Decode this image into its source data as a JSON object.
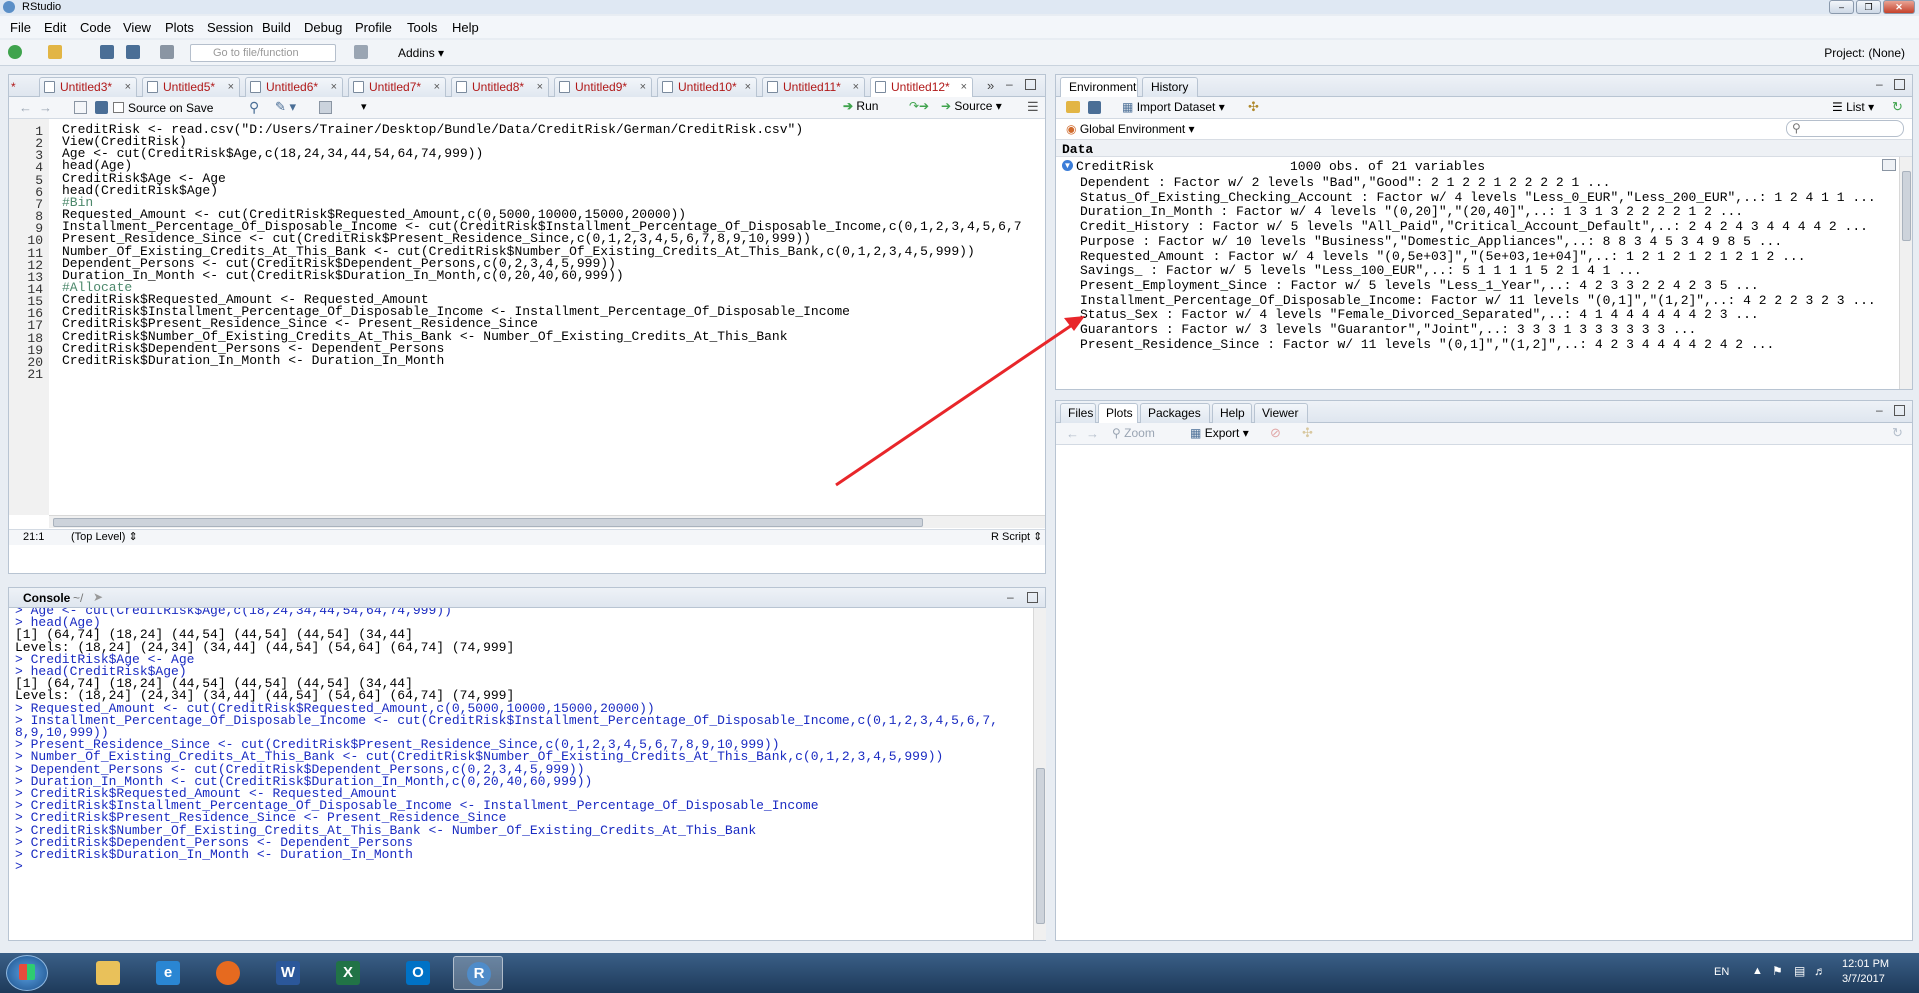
{
  "window": {
    "title": "RStudio"
  },
  "menu": [
    "File",
    "Edit",
    "Code",
    "View",
    "Plots",
    "Session",
    "Build",
    "Debug",
    "Profile",
    "Tools",
    "Help"
  ],
  "toolbar": {
    "goto_placeholder": "Go to file/function",
    "addins": "Addins",
    "project": "Project: (None)"
  },
  "editor": {
    "tabs": [
      "Untitled3*",
      "Untitled5*",
      "Untitled6*",
      "Untitled7*",
      "Untitled8*",
      "Untitled9*",
      "Untitled10*",
      "Untitled11*",
      "Untitled12*"
    ],
    "first_tab_partial": "*",
    "source_on_save": "Source on Save",
    "run": "Run",
    "source": "Source",
    "lines": [
      "CreditRisk <- read.csv(\"D:/Users/Trainer/Desktop/Bundle/Data/CreditRisk/German/CreditRisk.csv\")",
      "View(CreditRisk)",
      "Age <- cut(CreditRisk$Age,c(18,24,34,44,54,64,74,999))",
      "head(Age)",
      "CreditRisk$Age <- Age",
      "head(CreditRisk$Age)",
      "#Bin",
      "Requested_Amount <- cut(CreditRisk$Requested_Amount,c(0,5000,10000,15000,20000))",
      "Installment_Percentage_Of_Disposable_Income <- cut(CreditRisk$Installment_Percentage_Of_Disposable_Income,c(0,1,2,3,4,5,6,7",
      "Present_Residence_Since <- cut(CreditRisk$Present_Residence_Since,c(0,1,2,3,4,5,6,7,8,9,10,999))",
      "Number_Of_Existing_Credits_At_This_Bank <- cut(CreditRisk$Number_Of_Existing_Credits_At_This_Bank,c(0,1,2,3,4,5,999))",
      "Dependent_Persons <- cut(CreditRisk$Dependent_Persons,c(0,2,3,4,5,999))",
      "Duration_In_Month <- cut(CreditRisk$Duration_In_Month,c(0,20,40,60,999))",
      "#Allocate",
      "CreditRisk$Requested_Amount <- Requested_Amount",
      "CreditRisk$Installment_Percentage_Of_Disposable_Income <- Installment_Percentage_Of_Disposable_Income",
      "CreditRisk$Present_Residence_Since <- Present_Residence_Since",
      "CreditRisk$Number_Of_Existing_Credits_At_This_Bank <- Number_Of_Existing_Credits_At_This_Bank",
      "CreditRisk$Dependent_Persons <- Dependent_Persons",
      "CreditRisk$Duration_In_Month <- Duration_In_Month",
      ""
    ],
    "cursor_pos": "21:1",
    "scope": "(Top Level)",
    "file_type": "R Script"
  },
  "console": {
    "title": "Console",
    "path": "~/",
    "lines": [
      {
        "t": "> Age <- cut(CreditRisk$Age,c(18,24,34,44,54,64,74,999))",
        "cmd": true
      },
      {
        "t": "> head(Age)",
        "cmd": true
      },
      {
        "t": "[1] (64,74] (18,24] (44,54] (44,54] (44,54] (34,44]",
        "cmd": false
      },
      {
        "t": "Levels: (18,24] (24,34] (34,44] (44,54] (54,64] (64,74] (74,999]",
        "cmd": false
      },
      {
        "t": "> CreditRisk$Age <- Age",
        "cmd": true
      },
      {
        "t": "> head(CreditRisk$Age)",
        "cmd": true
      },
      {
        "t": "[1] (64,74] (18,24] (44,54] (44,54] (44,54] (34,44]",
        "cmd": false
      },
      {
        "t": "Levels: (18,24] (24,34] (34,44] (44,54] (54,64] (64,74] (74,999]",
        "cmd": false
      },
      {
        "t": "> Requested_Amount <- cut(CreditRisk$Requested_Amount,c(0,5000,10000,15000,20000))",
        "cmd": true
      },
      {
        "t": "> Installment_Percentage_Of_Disposable_Income <- cut(CreditRisk$Installment_Percentage_Of_Disposable_Income,c(0,1,2,3,4,5,6,7,",
        "cmd": true
      },
      {
        "t": "8,9,10,999))",
        "cmd": true
      },
      {
        "t": "> Present_Residence_Since <- cut(CreditRisk$Present_Residence_Since,c(0,1,2,3,4,5,6,7,8,9,10,999))",
        "cmd": true
      },
      {
        "t": "> Number_Of_Existing_Credits_At_This_Bank <- cut(CreditRisk$Number_Of_Existing_Credits_At_This_Bank,c(0,1,2,3,4,5,999))",
        "cmd": true
      },
      {
        "t": "> Dependent_Persons <- cut(CreditRisk$Dependent_Persons,c(0,2,3,4,5,999))",
        "cmd": true
      },
      {
        "t": "> Duration_In_Month <- cut(CreditRisk$Duration_In_Month,c(0,20,40,60,999))",
        "cmd": true
      },
      {
        "t": "> CreditRisk$Requested_Amount <- Requested_Amount",
        "cmd": true
      },
      {
        "t": "> CreditRisk$Installment_Percentage_Of_Disposable_Income <- Installment_Percentage_Of_Disposable_Income",
        "cmd": true
      },
      {
        "t": "> CreditRisk$Present_Residence_Since <- Present_Residence_Since",
        "cmd": true
      },
      {
        "t": "> CreditRisk$Number_Of_Existing_Credits_At_This_Bank <- Number_Of_Existing_Credits_At_This_Bank",
        "cmd": true
      },
      {
        "t": "> CreditRisk$Dependent_Persons <- Dependent_Persons",
        "cmd": true
      },
      {
        "t": "> CreditRisk$Duration_In_Month <- Duration_In_Month",
        "cmd": true
      },
      {
        "t": "> ",
        "cmd": true
      }
    ]
  },
  "environment": {
    "tabs": [
      "Environment",
      "History"
    ],
    "import_dataset": "Import Dataset",
    "view_mode": "List",
    "scope": "Global Environment",
    "section": "Data",
    "object_name": "CreditRisk",
    "object_summary": "1000 obs. of 21 variables",
    "rows": [
      "Dependent : Factor w/ 2 levels \"Bad\",\"Good\": 2 1 2 2 1 2 2 2 2 1 ...",
      "Status_Of_Existing_Checking_Account : Factor w/ 4 levels \"Less_0_EUR\",\"Less_200_EUR\",..: 1 2 4 1 1 ...",
      "Duration_In_Month : Factor w/ 4 levels \"(0,20]\",\"(20,40]\",..: 1 3 1 3 2 2 2 2 1 2 ...",
      "Credit_History : Factor w/ 5 levels \"All_Paid\",\"Critical_Account_Default\",..: 2 4 2 4 3 4 4 4 4 2 ...",
      "Purpose : Factor w/ 10 levels \"Business\",\"Domestic_Appliances\",..: 8 8 3 4 5 3 4 9 8 5 ...",
      "Requested_Amount : Factor w/ 4 levels \"(0,5e+03]\",\"(5e+03,1e+04]\",..: 1 2 1 2 1 2 1 2 1 2 ...",
      "Savings_ : Factor w/ 5 levels \"Less_100_EUR\",..: 5 1 1 1 1 5 2 1 4 1 ...",
      "Present_Employment_Since : Factor w/ 5 levels \"Less_1_Year\",..: 4 2 3 3 2 2 4 2 3 5 ...",
      "Installment_Percentage_Of_Disposable_Income: Factor w/ 11 levels \"(0,1]\",\"(1,2]\",..: 4 2 2 2 3 2 3 ...",
      "Status_Sex : Factor w/ 4 levels \"Female_Divorced_Separated\",..: 4 1 4 4 4 4 4 4 2 3 ...",
      "Guarantors : Factor w/ 3 levels \"Guarantor\",\"Joint\",..: 3 3 3 1 3 3 3 3 3 3 ...",
      "Present_Residence_Since : Factor w/ 11 levels \"(0,1]\",\"(1,2]\",..: 4 2 3 4 4 4 4 2 4 2 ..."
    ]
  },
  "files": {
    "tabs": [
      "Files",
      "Plots",
      "Packages",
      "Help",
      "Viewer"
    ],
    "zoom": "Zoom",
    "export": "Export"
  },
  "taskbar": {
    "language": "EN",
    "time": "12:01 PM",
    "date": "3/7/2017"
  },
  "colors": {
    "annotation_arrow": "#e8262a",
    "accent": "#3a5f87"
  }
}
